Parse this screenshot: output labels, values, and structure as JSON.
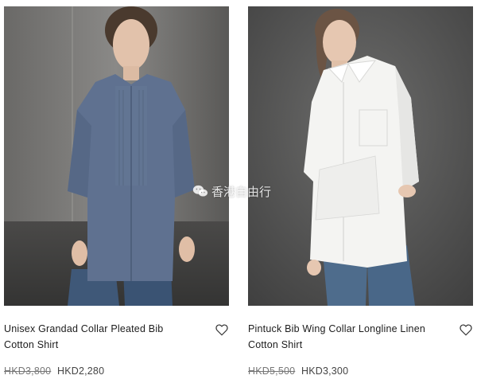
{
  "products": [
    {
      "name": "Unisex Grandad Collar Pleated Bib Cotton Shirt",
      "name_line1": "Unisex Grandad Collar Pleated Bib",
      "name_line2": "Cotton Shirt",
      "price_original": "HKD3,800",
      "price_sale": "HKD2,280",
      "image_icon": "model-blue-shirt-photo",
      "colors": {
        "background": "#5e5d5b",
        "shirt": "#5f7190",
        "jeans": "#3f5878"
      }
    },
    {
      "name": "Pintuck Bib Wing Collar Longline Linen Cotton Shirt",
      "name_line1": "Pintuck Bib Wing Collar Longline Linen",
      "name_line2": "Cotton Shirt",
      "price_original": "HKD5,500",
      "price_sale": "HKD3,300",
      "image_icon": "model-white-shirt-photo",
      "colors": {
        "background": "#4f4f4f",
        "shirt": "#f4f4f2",
        "jeans": "#4e6c8c"
      }
    }
  ],
  "watermark": {
    "text": "香港自由行",
    "icon": "wechat-icon"
  }
}
